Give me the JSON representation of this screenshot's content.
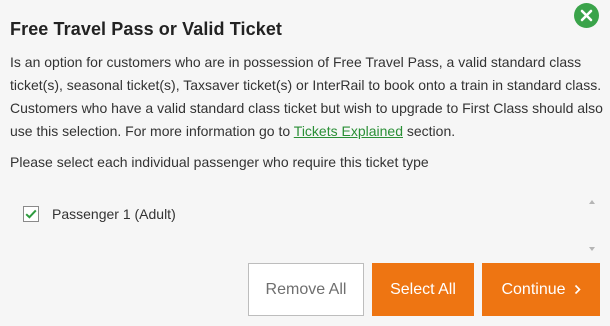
{
  "dialog": {
    "title": "Free Travel Pass or Valid Ticket",
    "close_icon": "close-icon",
    "description_before_link": "Is an option for customers who are in possession of Free Travel Pass, a valid standard class ticket(s), seasonal ticket(s), Taxsaver ticket(s) or InterRail to book onto a train in standard class. Customers who have a valid standard class ticket but wish to upgrade to First Class should also use this selection. For more information go to ",
    "description_link": "Tickets Explained",
    "description_after_link": " section.",
    "prompt": "Please select each individual passenger who require this ticket type"
  },
  "passengers": [
    {
      "label": "Passenger 1 (Adult)",
      "checked": true
    }
  ],
  "buttons": {
    "remove_all": "Remove All",
    "select_all": "Select All",
    "continue": "Continue",
    "continue_icon": "chevron-right-icon"
  },
  "colors": {
    "accent_orange": "#ee7512",
    "close_green": "#3aa34a",
    "link_green": "#2a8f36",
    "check_green": "#2e9b3e"
  }
}
